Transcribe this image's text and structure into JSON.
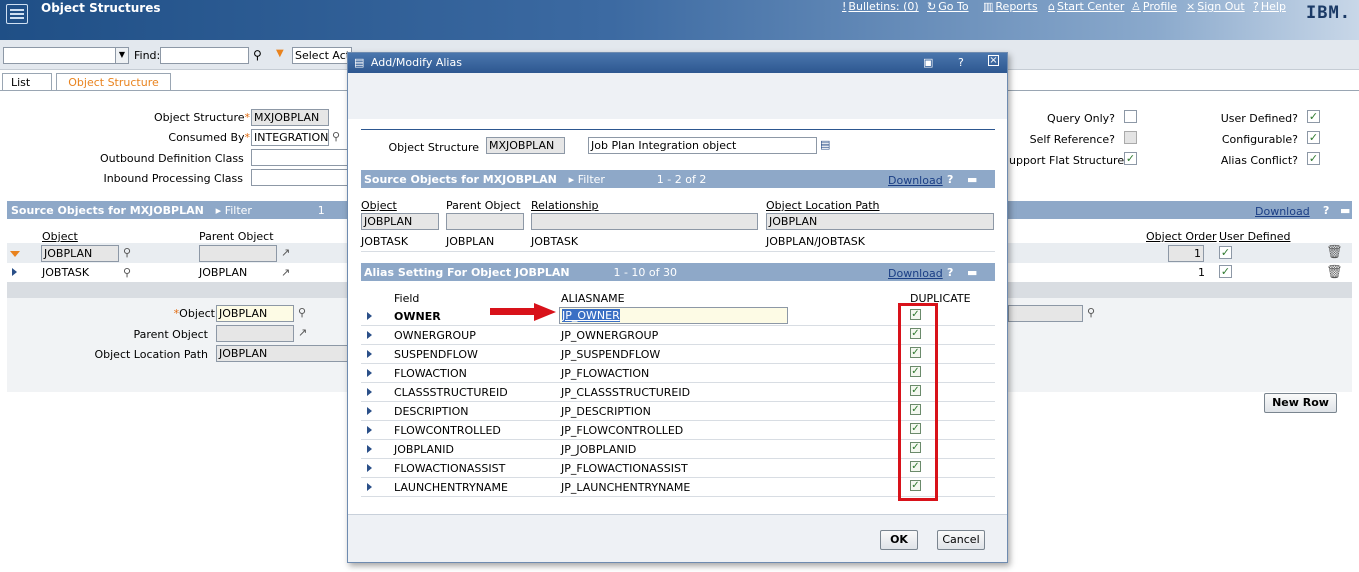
{
  "header": {
    "title": "Object Structures",
    "nav": {
      "bulletins": "Bulletins: (0)",
      "goto": "Go To",
      "reports": "Reports",
      "start_center": "Start Center",
      "profile": "Profile",
      "sign_out": "Sign Out",
      "help": "Help"
    },
    "logo": "IBM."
  },
  "toolbar": {
    "find_label": "Find:",
    "action_select": "Select Action"
  },
  "tabs": {
    "list": "List",
    "object_structure": "Object Structure"
  },
  "main": {
    "object_structure_label": "Object Structure",
    "object_structure_value": "MXJOBPLAN",
    "consumed_by_label": "Consumed By",
    "consumed_by_value": "INTEGRATION",
    "outbound_label": "Outbound Definition Class",
    "inbound_label": "Inbound Processing Class",
    "query_only_label": "Query Only?",
    "self_reference_label": "Self Reference?",
    "flat_structure_label": "upport Flat Structure?",
    "user_defined_label": "User Defined?",
    "configurable_label": "Configurable?",
    "alias_conflict_label": "Alias Conflict?",
    "source_bar": "Source Objects for MXJOBPLAN",
    "source_filter": "Filter",
    "source_count": "1",
    "download": "Download",
    "col_object": "Object",
    "col_parent": "Parent Object",
    "col_order": "Object Order",
    "col_user_defined": "User Defined",
    "filter_object": "JOBPLAN",
    "filter_order": "1",
    "row_object": "JOBTASK",
    "row_parent": "JOBPLAN",
    "row_order": "1",
    "detail_object_label": "Object",
    "detail_object_value": "JOBPLAN",
    "detail_parent_label": "Parent Object",
    "detail_path_label": "Object Location Path",
    "detail_path_value": "JOBPLAN",
    "new_row": "New Row"
  },
  "dialog": {
    "title": "Add/Modify Alias",
    "os_label": "Object Structure",
    "os_value": "MXJOBPLAN",
    "os_desc": "Job Plan Integration object",
    "source": {
      "bar": "Source Objects for MXJOBPLAN",
      "filter": "Filter",
      "paging": "1 - 2 of 2",
      "download": "Download",
      "col_object": "Object",
      "col_parent": "Parent Object",
      "col_relationship": "Relationship",
      "col_path": "Object Location Path",
      "filter_object": "JOBPLAN",
      "filter_path": "JOBPLAN",
      "row": {
        "object": "JOBTASK",
        "parent": "JOBPLAN",
        "relationship": "JOBTASK",
        "path": "JOBPLAN/JOBTASK"
      }
    },
    "alias": {
      "bar": "Alias Setting For Object JOBPLAN",
      "paging": "1 - 10 of 30",
      "download": "Download",
      "col_field": "Field",
      "col_alias": "ALIASNAME",
      "col_dup": "DUPLICATE",
      "rows": [
        {
          "field": "OWNER",
          "alias": "JP_OWNER"
        },
        {
          "field": "OWNERGROUP",
          "alias": "JP_OWNERGROUP"
        },
        {
          "field": "SUSPENDFLOW",
          "alias": "JP_SUSPENDFLOW"
        },
        {
          "field": "FLOWACTION",
          "alias": "JP_FLOWACTION"
        },
        {
          "field": "CLASSSTRUCTUREID",
          "alias": "JP_CLASSSTRUCTUREID"
        },
        {
          "field": "DESCRIPTION",
          "alias": "JP_DESCRIPTION"
        },
        {
          "field": "FLOWCONTROLLED",
          "alias": "JP_FLOWCONTROLLED"
        },
        {
          "field": "JOBPLANID",
          "alias": "JP_JOBPLANID"
        },
        {
          "field": "FLOWACTIONASSIST",
          "alias": "JP_FLOWACTIONASSIST"
        },
        {
          "field": "LAUNCHENTRYNAME",
          "alias": "JP_LAUNCHENTRYNAME"
        }
      ]
    },
    "ok": "OK",
    "cancel": "Cancel"
  },
  "colors": {
    "accent_red": "#d8121a",
    "header_blue": "#1f4f86",
    "section_blue": "#8ea8c8"
  }
}
